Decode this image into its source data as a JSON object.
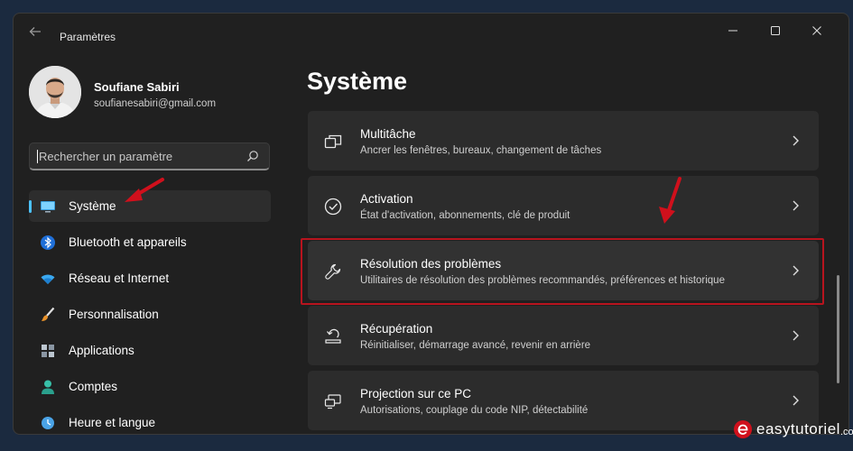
{
  "window": {
    "title": "Paramètres"
  },
  "profile": {
    "name": "Soufiane Sabiri",
    "email": "soufianesabiri@gmail.com"
  },
  "search": {
    "placeholder": "Rechercher un paramètre",
    "value": ""
  },
  "nav": {
    "items": [
      {
        "label": "Système",
        "icon": "monitor-icon",
        "selected": true
      },
      {
        "label": "Bluetooth et appareils",
        "icon": "bluetooth-icon"
      },
      {
        "label": "Réseau et Internet",
        "icon": "wifi-icon"
      },
      {
        "label": "Personnalisation",
        "icon": "brush-icon"
      },
      {
        "label": "Applications",
        "icon": "apps-icon"
      },
      {
        "label": "Comptes",
        "icon": "person-icon"
      },
      {
        "label": "Heure et langue",
        "icon": "clock-globe-icon"
      }
    ]
  },
  "main": {
    "title": "Système",
    "cards": [
      {
        "title": "Multitâche",
        "subtitle": "Ancrer les fenêtres, bureaux, changement de tâches",
        "icon": "multitask-icon"
      },
      {
        "title": "Activation",
        "subtitle": "État d'activation, abonnements, clé de produit",
        "icon": "check-circle-icon"
      },
      {
        "title": "Résolution des problèmes",
        "subtitle": "Utilitaires de résolution des problèmes recommandés, préférences et historique",
        "icon": "wrench-icon"
      },
      {
        "title": "Récupération",
        "subtitle": "Réinitialiser, démarrage avancé, revenir en arrière",
        "icon": "recovery-icon"
      },
      {
        "title": "Projection sur ce PC",
        "subtitle": "Autorisations, couplage du code NIP, détectabilité",
        "icon": "projection-icon"
      }
    ]
  },
  "watermark": {
    "text": "easytutoriel",
    "suffix": ".com"
  },
  "colors": {
    "accent": "#4cc2ff",
    "annotation_red": "#d0101c",
    "background": "#202020",
    "card": "#2c2c2c"
  }
}
